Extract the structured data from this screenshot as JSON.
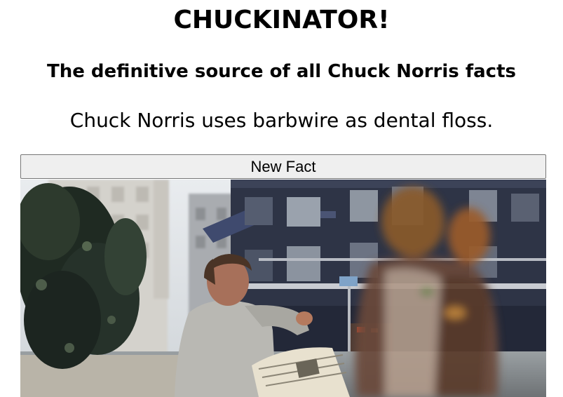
{
  "header": {
    "title": "CHUCKINATOR!",
    "subtitle": "The definitive source of all Chuck Norris facts"
  },
  "fact": {
    "text": "Chuck Norris uses barbwire as dental floss."
  },
  "controls": {
    "new_fact_label": "New Fact"
  },
  "media": {
    "image_alt": "Animated street scene: a man in a grey sweater holding a newspaper while a blurred figure rushes past"
  },
  "colors": {
    "button_bg": "#efefef",
    "button_border": "#767676"
  }
}
